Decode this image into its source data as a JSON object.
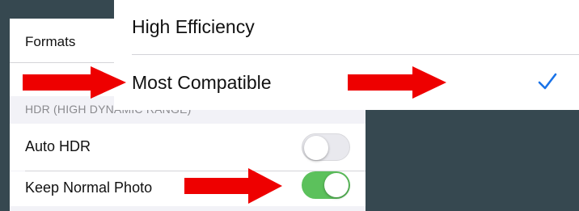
{
  "settings_list": {
    "formats_label": "Formats",
    "hdr_section_header": "HDR (HIGH DYNAMIC RANGE)",
    "auto_hdr": {
      "label": "Auto HDR",
      "on": false
    },
    "keep_normal_photo": {
      "label": "Keep Normal Photo",
      "on": true
    }
  },
  "format_popup": {
    "options": [
      {
        "label": "High Efficiency",
        "selected": false
      },
      {
        "label": "Most Compatible",
        "selected": true
      }
    ]
  },
  "colors": {
    "toggle_on": "#5cc15c",
    "checkmark": "#1a73e8",
    "annotation_arrow": "#ee0000"
  },
  "icons": {
    "checkmark": "checkmark-icon",
    "arrow": "right-arrow-icon"
  }
}
